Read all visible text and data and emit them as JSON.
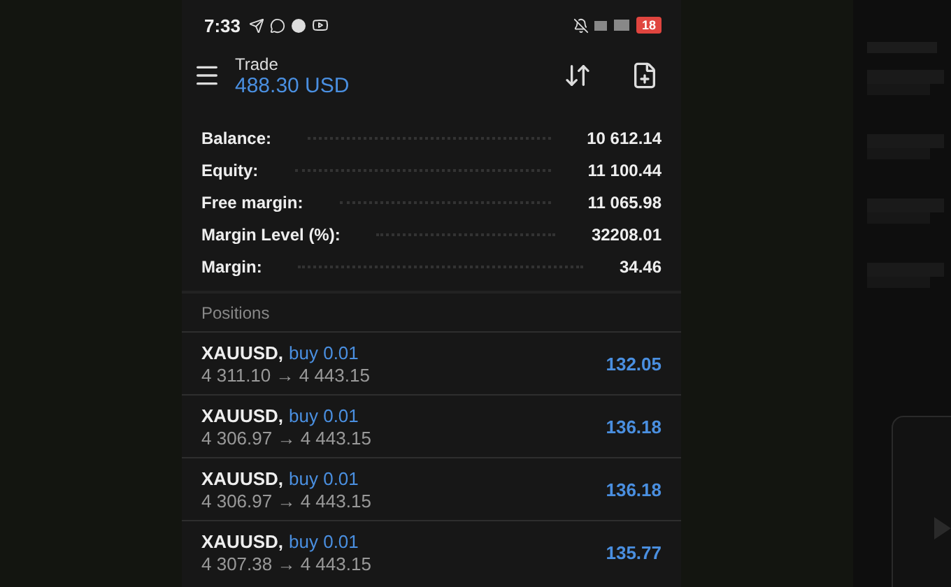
{
  "status_bar": {
    "time": "7:33",
    "battery": "18"
  },
  "header": {
    "title": "Trade",
    "subtitle": "488.30 USD"
  },
  "summary": [
    {
      "label": "Balance:",
      "value": "10 612.14"
    },
    {
      "label": "Equity:",
      "value": "11 100.44"
    },
    {
      "label": "Free margin:",
      "value": "11 065.98"
    },
    {
      "label": "Margin Level (%):",
      "value": "32208.01"
    },
    {
      "label": "Margin:",
      "value": "34.46"
    }
  ],
  "positions": {
    "title": "Positions",
    "rows": [
      {
        "symbol": "XAUUSD,",
        "side": "buy 0.01",
        "prices": "4 311.10 → 4 443.15",
        "profit": "132.05"
      },
      {
        "symbol": "XAUUSD,",
        "side": "buy 0.01",
        "prices": "4 306.97 → 4 443.15",
        "profit": "136.18"
      },
      {
        "symbol": "XAUUSD,",
        "side": "buy 0.01",
        "prices": "4 306.97 → 4 443.15",
        "profit": "136.18"
      },
      {
        "symbol": "XAUUSD,",
        "side": "buy 0.01",
        "prices": "4 307.38 → 4 443.15",
        "profit": "135.77"
      }
    ]
  }
}
